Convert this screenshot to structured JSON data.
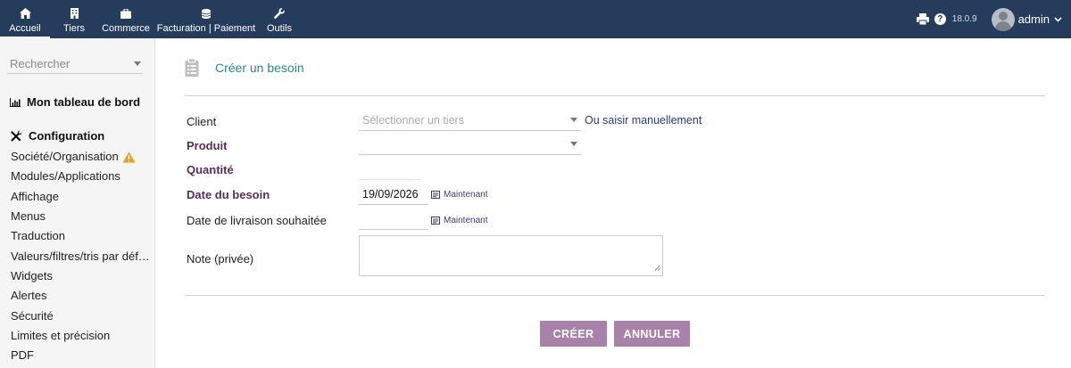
{
  "topmenu": [
    {
      "label": "Accueil",
      "icon": "home-icon",
      "active": true
    },
    {
      "label": "Tiers",
      "icon": "building-icon"
    },
    {
      "label": "Commerce",
      "icon": "briefcase-icon"
    },
    {
      "label": "Facturation | Paiement",
      "icon": "coins-icon"
    },
    {
      "label": "Outils",
      "icon": "wrench-icon"
    }
  ],
  "topright": {
    "version": "18.0.9",
    "user": "admin",
    "help": "?"
  },
  "sidebar": {
    "search_placeholder": "Rechercher",
    "dashboard_label": "Mon tableau de bord",
    "config_label": "Configuration",
    "items": [
      {
        "label": "Société/Organisation",
        "warning": true
      },
      {
        "label": "Modules/Applications"
      },
      {
        "label": "Affichage"
      },
      {
        "label": "Menus"
      },
      {
        "label": "Traduction"
      },
      {
        "label": "Valeurs/filtres/tris par déf…"
      },
      {
        "label": "Widgets"
      },
      {
        "label": "Alertes"
      },
      {
        "label": "Sécurité"
      },
      {
        "label": "Limites et précision"
      },
      {
        "label": "PDF"
      }
    ]
  },
  "form": {
    "title": "Créer un besoin",
    "client_label": "Client",
    "client_placeholder": "Sélectionner un tiers",
    "manual_link": "Ou saisir manuellement",
    "product_label": "Produit",
    "quantity_label": "Quantité",
    "need_date_label": "Date du besoin",
    "need_date_value": "19/09/2026",
    "delivery_date_label": "Date de livraison souhaitée",
    "now_label": "Maintenant",
    "note_label": "Note (privée)",
    "create_button": "CRÉER",
    "cancel_button": "ANNULER"
  },
  "colors": {
    "topbar": "#263c5c",
    "title": "#2a8a8a",
    "required_label": "#5a2d58",
    "button": "#a882a8"
  }
}
